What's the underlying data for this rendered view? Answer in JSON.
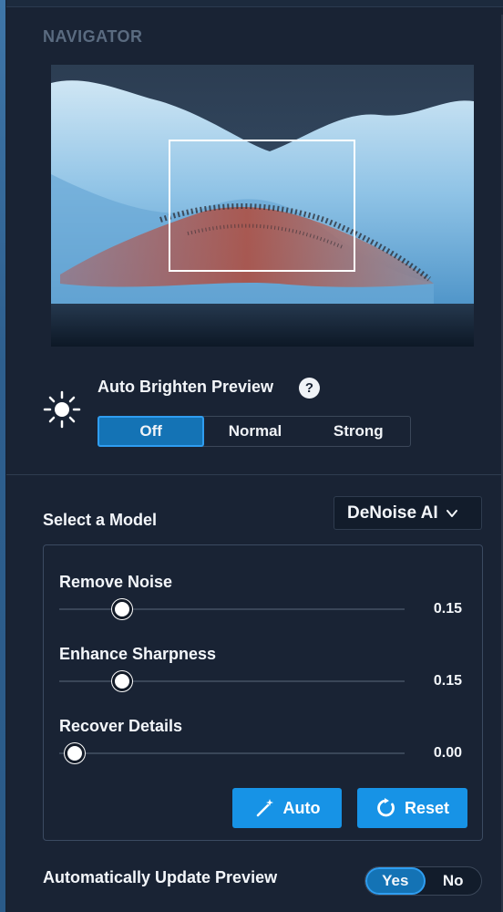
{
  "navigator": {
    "title": "NAVIGATOR"
  },
  "auto_brighten": {
    "label": "Auto Brighten Preview",
    "help": "?",
    "options": [
      "Off",
      "Normal",
      "Strong"
    ],
    "selected": "Off"
  },
  "model": {
    "label": "Select a Model",
    "selected": "DeNoise AI"
  },
  "sliders": [
    {
      "label": "Remove Noise",
      "value": "0.15",
      "fraction": 0.15
    },
    {
      "label": "Enhance Sharpness",
      "value": "0.15",
      "fraction": 0.15
    },
    {
      "label": "Recover Details",
      "value": "0.00",
      "fraction": 0.0
    }
  ],
  "buttons": {
    "auto": "Auto",
    "reset": "Reset"
  },
  "auto_update": {
    "label": "Automatically Update Preview",
    "options": [
      "Yes",
      "No"
    ],
    "selected": "Yes"
  },
  "colors": {
    "accent": "#1793e6",
    "panel": "#192334",
    "active_border": "#2f9df0"
  },
  "icons": {
    "brightness": "sun-icon",
    "help": "question-icon",
    "dropdown": "chevron-down-icon",
    "auto": "magic-wand-icon",
    "reset": "reset-icon"
  }
}
